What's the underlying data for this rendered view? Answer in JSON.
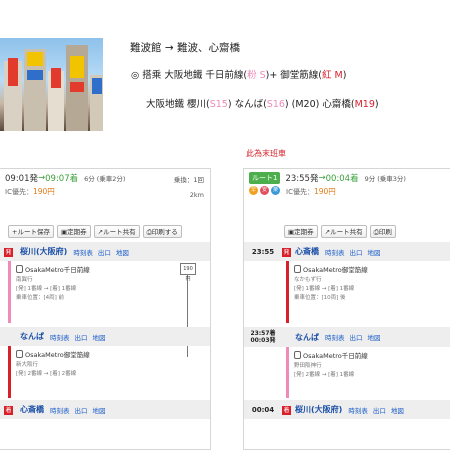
{
  "header": {
    "route_title": "難波館 → 難波、心齋橋",
    "line1_prefix": "◎ 搭乘 大阪地鐵 千日前線(",
    "line1_code": "粉 S",
    "line1_mid": ")+ 御堂筋線(",
    "line1_code2": "紅 M",
    "line1_end": ")",
    "line2_prefix": "大阪地鐵 櫻川(",
    "line2_s15": "S15",
    "line2_mid": ") なんば(",
    "line2_s16": "S16",
    "line2_mid2": ") (M20) 心齋橋(",
    "line2_m19": "M19",
    "line2_end": ")",
    "last_train_note": "此為末班車"
  },
  "left_card": {
    "dep_time": "09:01発",
    "arrow": "→",
    "arr_time": "09:07着",
    "duration": "6分",
    "ride": "(乗車2分)",
    "transfer": "乗換：1回",
    "distance": "2km",
    "fare_label": "IC優先：",
    "fare": "190円",
    "buttons": [
      "ルート保存",
      "定期券",
      "ルート共有",
      "印刷する"
    ],
    "stations": [
      {
        "name": "桜川(大阪府)",
        "links": [
          "時刻表",
          "出口",
          "地図"
        ]
      },
      {
        "name": "なんば",
        "links": [
          "時刻表",
          "出口",
          "地図"
        ]
      },
      {
        "name": "心斎橋",
        "links": [
          "時刻表",
          "出口",
          "地図"
        ]
      }
    ],
    "seg1": {
      "line": "OsakaMetro千日前線",
      "dir": "南巽行",
      "cars": "[発] 1番線 → [着] 1番線",
      "pos": "乗車位置：[4両] 前",
      "fare_box": "190円"
    },
    "seg2": {
      "line": "OsakaMetro御堂筋線",
      "dir": "新大阪行",
      "cars": "[発] 2番線 → [着] 2番線"
    }
  },
  "right_card": {
    "route_chip": "ルート1",
    "dep_time": "23:55発",
    "arrow": "→",
    "arr_time": "00:04着",
    "duration": "9分",
    "ride": "(乗車3分)",
    "fare_label": "IC優先：",
    "fare": "190円",
    "badges": [
      "早",
      "安",
      "楽"
    ],
    "buttons": [
      "定期券",
      "ルート共有",
      "印刷"
    ],
    "stations": [
      {
        "time": "23:55",
        "name": "心斎橋",
        "links": [
          "時刻表",
          "出口",
          "地図"
        ]
      },
      {
        "time": "23:57着\n00:03発",
        "name": "なんば",
        "links": [
          "時刻表",
          "出口",
          "地図"
        ]
      },
      {
        "time": "00:04",
        "name": "桜川(大阪府)",
        "links": [
          "時刻表",
          "出口",
          "地図"
        ]
      }
    ],
    "seg1": {
      "line": "OsakaMetro御堂筋線",
      "dir": "なかもず行",
      "cars": "[発] 1番線 → [着] 1番線",
      "pos": "乗車位置：[10両] 後"
    },
    "seg2": {
      "line": "OsakaMetro千日前線",
      "dir": "野田阪神行",
      "cars": "[発] 2番線 → [着] 1番線"
    }
  },
  "colors": {
    "accent_red": "#d8202a",
    "accent_pink": "#f08bb9",
    "accent_green": "#4cae4c",
    "fare_orange": "#e07a1a",
    "link_blue": "#1a5dc9"
  }
}
